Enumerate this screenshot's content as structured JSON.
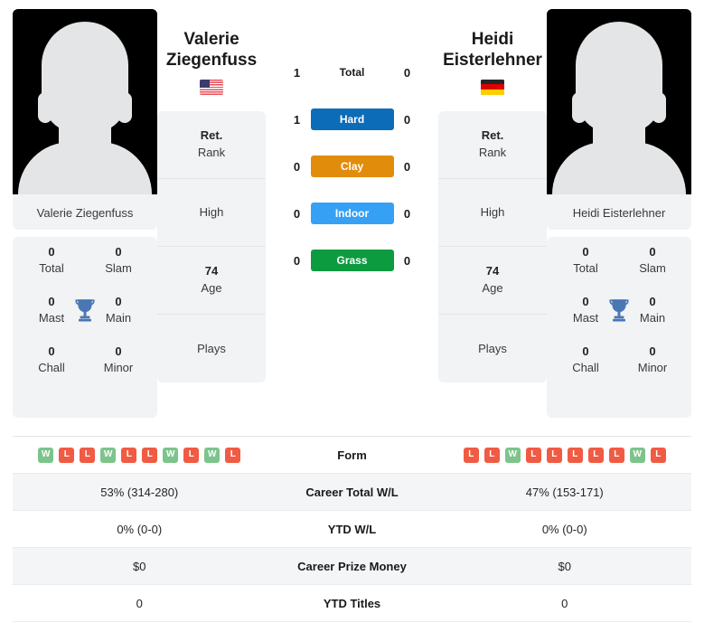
{
  "players": {
    "left": {
      "first_name": "Valerie",
      "last_name": "Ziegenfuss",
      "full_name": "Valerie Ziegenfuss",
      "country_flag": "us-flag-icon",
      "avatar": "player-photo-placeholder",
      "titles": [
        {
          "num": "0",
          "label": "Total"
        },
        {
          "num": "0",
          "label": "Slam"
        },
        {
          "num": "0",
          "label": "Mast"
        },
        {
          "num": "0",
          "label": "Main"
        },
        {
          "num": "0",
          "label": "Chall"
        },
        {
          "num": "0",
          "label": "Minor"
        }
      ],
      "info": [
        {
          "value": "Ret.",
          "key": "Rank"
        },
        {
          "value": "",
          "key": "High"
        },
        {
          "value": "74",
          "key": "Age"
        },
        {
          "value": "",
          "key": "Plays"
        }
      ],
      "form": [
        "W",
        "L",
        "L",
        "W",
        "L",
        "L",
        "W",
        "L",
        "W",
        "L"
      ],
      "career_total_wl": "53% (314-280)",
      "ytd_wl": "0% (0-0)",
      "career_prize_money": "$0",
      "ytd_titles": "0"
    },
    "right": {
      "first_name": "Heidi",
      "last_name": "Eisterlehner",
      "full_name": "Heidi Eisterlehner",
      "country_flag": "de-flag-icon",
      "avatar": "player-photo-placeholder",
      "titles": [
        {
          "num": "0",
          "label": "Total"
        },
        {
          "num": "0",
          "label": "Slam"
        },
        {
          "num": "0",
          "label": "Mast"
        },
        {
          "num": "0",
          "label": "Main"
        },
        {
          "num": "0",
          "label": "Chall"
        },
        {
          "num": "0",
          "label": "Minor"
        }
      ],
      "info": [
        {
          "value": "Ret.",
          "key": "Rank"
        },
        {
          "value": "",
          "key": "High"
        },
        {
          "value": "74",
          "key": "Age"
        },
        {
          "value": "",
          "key": "Plays"
        }
      ],
      "form": [
        "L",
        "L",
        "W",
        "L",
        "L",
        "L",
        "L",
        "L",
        "W",
        "L"
      ],
      "career_total_wl": "47% (153-171)",
      "ytd_wl": "0% (0-0)",
      "career_prize_money": "$0",
      "ytd_titles": "0"
    }
  },
  "head_to_head": [
    {
      "label": "Total",
      "left": "1",
      "right": "0",
      "color": "",
      "style": "plain"
    },
    {
      "label": "Hard",
      "left": "1",
      "right": "0",
      "color": "#0c6cb8",
      "style": "badge"
    },
    {
      "label": "Clay",
      "left": "0",
      "right": "0",
      "color": "#e28c0c",
      "style": "badge"
    },
    {
      "label": "Indoor",
      "left": "0",
      "right": "0",
      "color": "#36a0f5",
      "style": "badge"
    },
    {
      "label": "Grass",
      "left": "0",
      "right": "0",
      "color": "#0d9b3f",
      "style": "badge"
    }
  ],
  "stats_rows": [
    {
      "label": "Form",
      "left": "",
      "right": "",
      "type": "form"
    },
    {
      "label": "Career Total W/L",
      "left": "53% (314-280)",
      "right": "47% (153-171)",
      "type": "text"
    },
    {
      "label": "YTD W/L",
      "left": "0% (0-0)",
      "right": "0% (0-0)",
      "type": "text"
    },
    {
      "label": "Career Prize Money",
      "left": "$0",
      "right": "$0",
      "type": "text"
    },
    {
      "label": "YTD Titles",
      "left": "0",
      "right": "0",
      "type": "text"
    }
  ],
  "colors": {
    "hard": "#0c6cb8",
    "clay": "#e28c0c",
    "indoor": "#36a0f5",
    "grass": "#0d9b3f",
    "win": "#7cc48b",
    "loss": "#f15b43",
    "card_bg": "#f1f3f4"
  }
}
